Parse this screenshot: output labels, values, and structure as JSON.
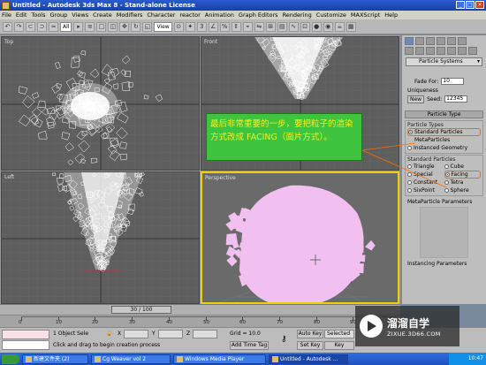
{
  "window": {
    "title": "Untitled - Autodesk 3ds Max 8 - Stand-alone License",
    "buttons": [
      "_",
      "□",
      "×"
    ]
  },
  "menu": [
    "File",
    "Edit",
    "Tools",
    "Group",
    "Views",
    "Create",
    "Modifiers",
    "Character",
    "reactor",
    "Animation",
    "Graph Editors",
    "Rendering",
    "Customize",
    "MAXScript",
    "Help"
  ],
  "toolbar": {
    "selection_filter": "All",
    "reference_coord": "View"
  },
  "viewports": {
    "top_label": "Top",
    "front_label": "Front",
    "left_label": "Left",
    "perspective_label": "Perspective"
  },
  "annotation": {
    "text": "最后非常重要的一步，要把粒子的渲染方式改成 FACING（面片方式）。"
  },
  "command_panel": {
    "category": "Particle Systems",
    "fade_for_label": "Fade For:",
    "fade_for_value": "10",
    "uniqueness_label": "Uniqueness",
    "new_label": "New",
    "seed_label": "Seed:",
    "seed_value": "12345",
    "particle_type_rollout": "Particle Type",
    "particle_types_group": "Particle Types",
    "standard_particles": "Standard Particles",
    "metaparticles": "MetaParticles",
    "instanced_geometry": "Instanced Geometry",
    "standard_particles_group": "Standard Particles",
    "std_options": [
      "Triangle",
      "Cube",
      "Special",
      "Facing",
      "Constant",
      "Tetra",
      "SixPoint",
      "Sphere"
    ],
    "metaparticle_params": "MetaParticle Parameters",
    "instancing_params": "Instancing Parameters"
  },
  "time_slider": {
    "frame": "30 / 100"
  },
  "trackbar": {
    "ticks": [
      "0",
      "10",
      "20",
      "30",
      "40",
      "50",
      "60",
      "70",
      "80",
      "90",
      "100"
    ]
  },
  "status": {
    "object_count": "1 Object Sele",
    "prompt": "Click and drag to begin creation process",
    "x_label": "X",
    "y_label": "Y",
    "z_label": "Z",
    "grid": "Grid = 10.0",
    "add_time_tag": "Add Time Tag",
    "auto_key": "Auto Key",
    "selected": "Selected",
    "set_key": "Set Key",
    "key_filters": "Key"
  },
  "watermark": {
    "title": "溜溜自学",
    "url": "ZIXUE.3D66.COM"
  },
  "taskbar": {
    "items": [
      "新建文件夹 (2)",
      "Cg Weaver vol 2",
      "Windows Media Player",
      "Untitled - Autodesk ..."
    ],
    "clock": "10:47"
  },
  "colors": {
    "viewport_bg": "#5e5e5e",
    "particle_pink": "#f2c0f0",
    "annotation_bg": "#3ec43e",
    "annotation_text": "#f4f020",
    "highlight": "#ff6a00",
    "active_border": "#f0d000"
  }
}
